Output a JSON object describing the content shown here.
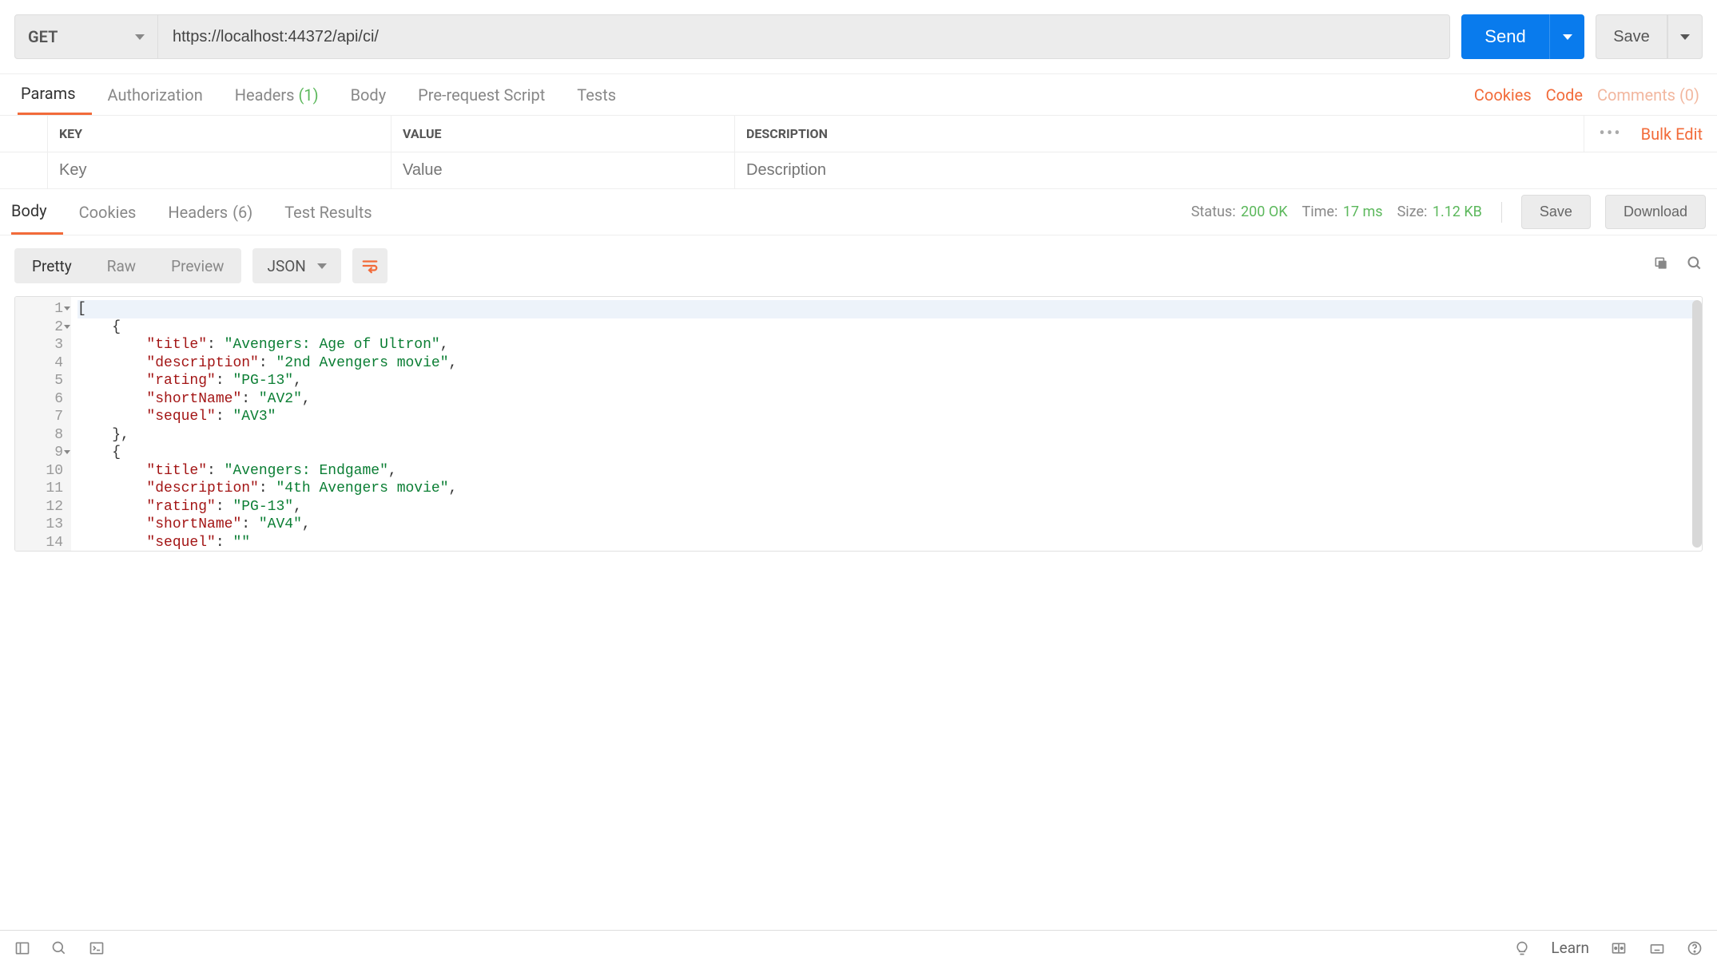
{
  "request": {
    "method": "GET",
    "url": "https://localhost:44372/api/ci/",
    "sendLabel": "Send",
    "saveLabel": "Save"
  },
  "requestTabs": {
    "params": "Params",
    "authorization": "Authorization",
    "headers": "Headers",
    "headersCount": "(1)",
    "body": "Body",
    "preRequest": "Pre-request Script",
    "tests": "Tests",
    "cookies": "Cookies",
    "code": "Code",
    "comments": "Comments (0)"
  },
  "paramsTable": {
    "keyHeader": "KEY",
    "valueHeader": "VALUE",
    "descHeader": "DESCRIPTION",
    "bulkEdit": "Bulk Edit",
    "keyPlaceholder": "Key",
    "valuePlaceholder": "Value",
    "descPlaceholder": "Description"
  },
  "responseTabs": {
    "body": "Body",
    "cookies": "Cookies",
    "headers": "Headers",
    "headersCount": "(6)",
    "testResults": "Test Results"
  },
  "responseMeta": {
    "statusLabel": "Status:",
    "statusValue": "200 OK",
    "timeLabel": "Time:",
    "timeValue": "17 ms",
    "sizeLabel": "Size:",
    "sizeValue": "1.12 KB",
    "saveLabel": "Save",
    "downloadLabel": "Download"
  },
  "formatBar": {
    "pretty": "Pretty",
    "raw": "Raw",
    "preview": "Preview",
    "type": "JSON"
  },
  "responseBody": {
    "lineNumbers": [
      "1",
      "2",
      "3",
      "4",
      "5",
      "6",
      "7",
      "8",
      "9",
      "10",
      "11",
      "12",
      "13",
      "14"
    ],
    "foldLines": [
      0,
      1,
      8
    ],
    "lines": [
      {
        "indent": 0,
        "tokens": [
          {
            "t": "punc",
            "v": "["
          }
        ]
      },
      {
        "indent": 1,
        "tokens": [
          {
            "t": "punc",
            "v": "{"
          }
        ]
      },
      {
        "indent": 2,
        "tokens": [
          {
            "t": "key",
            "v": "\"title\""
          },
          {
            "t": "punc",
            "v": ": "
          },
          {
            "t": "str",
            "v": "\"Avengers: Age of Ultron\""
          },
          {
            "t": "punc",
            "v": ","
          }
        ]
      },
      {
        "indent": 2,
        "tokens": [
          {
            "t": "key",
            "v": "\"description\""
          },
          {
            "t": "punc",
            "v": ": "
          },
          {
            "t": "str",
            "v": "\"2nd Avengers movie\""
          },
          {
            "t": "punc",
            "v": ","
          }
        ]
      },
      {
        "indent": 2,
        "tokens": [
          {
            "t": "key",
            "v": "\"rating\""
          },
          {
            "t": "punc",
            "v": ": "
          },
          {
            "t": "str",
            "v": "\"PG-13\""
          },
          {
            "t": "punc",
            "v": ","
          }
        ]
      },
      {
        "indent": 2,
        "tokens": [
          {
            "t": "key",
            "v": "\"shortName\""
          },
          {
            "t": "punc",
            "v": ": "
          },
          {
            "t": "str",
            "v": "\"AV2\""
          },
          {
            "t": "punc",
            "v": ","
          }
        ]
      },
      {
        "indent": 2,
        "tokens": [
          {
            "t": "key",
            "v": "\"sequel\""
          },
          {
            "t": "punc",
            "v": ": "
          },
          {
            "t": "str",
            "v": "\"AV3\""
          }
        ]
      },
      {
        "indent": 1,
        "tokens": [
          {
            "t": "punc",
            "v": "},"
          }
        ]
      },
      {
        "indent": 1,
        "tokens": [
          {
            "t": "punc",
            "v": "{"
          }
        ]
      },
      {
        "indent": 2,
        "tokens": [
          {
            "t": "key",
            "v": "\"title\""
          },
          {
            "t": "punc",
            "v": ": "
          },
          {
            "t": "str",
            "v": "\"Avengers: Endgame\""
          },
          {
            "t": "punc",
            "v": ","
          }
        ]
      },
      {
        "indent": 2,
        "tokens": [
          {
            "t": "key",
            "v": "\"description\""
          },
          {
            "t": "punc",
            "v": ": "
          },
          {
            "t": "str",
            "v": "\"4th Avengers movie\""
          },
          {
            "t": "punc",
            "v": ","
          }
        ]
      },
      {
        "indent": 2,
        "tokens": [
          {
            "t": "key",
            "v": "\"rating\""
          },
          {
            "t": "punc",
            "v": ": "
          },
          {
            "t": "str",
            "v": "\"PG-13\""
          },
          {
            "t": "punc",
            "v": ","
          }
        ]
      },
      {
        "indent": 2,
        "tokens": [
          {
            "t": "key",
            "v": "\"shortName\""
          },
          {
            "t": "punc",
            "v": ": "
          },
          {
            "t": "str",
            "v": "\"AV4\""
          },
          {
            "t": "punc",
            "v": ","
          }
        ]
      },
      {
        "indent": 2,
        "tokens": [
          {
            "t": "key",
            "v": "\"sequel\""
          },
          {
            "t": "punc",
            "v": ": "
          },
          {
            "t": "str",
            "v": "\"\""
          }
        ]
      }
    ]
  },
  "bottomBar": {
    "learn": "Learn"
  }
}
